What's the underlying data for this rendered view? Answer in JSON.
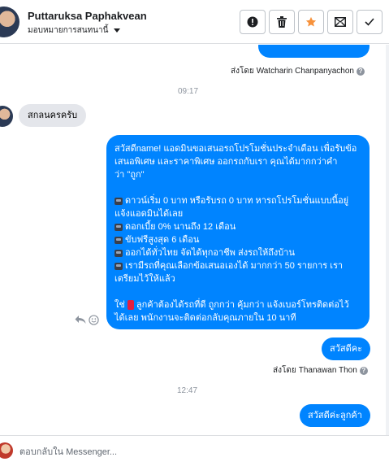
{
  "header": {
    "name": "Puttaruksa Paphakvean",
    "assign_label": "มอบหมายการสนทนานี้",
    "actions": [
      "spam-icon",
      "trash-icon",
      "star-icon",
      "mail-icon",
      "check-icon"
    ],
    "star_color": "#f7923b"
  },
  "messages": {
    "top_sent_by_prefix": "ส่งโดย",
    "top_sent_by": "Watcharin Chanpanyachon",
    "time1": "09:17",
    "incoming": "สกลนครครับ",
    "promo": {
      "line1": "สวัสดีname! แอดมินขอเสนอรถโปรโมชั่นประจำเดือน เพื่อรับข้อ",
      "line2": "เสนอพิเศษ และราคาพิเศษ ออกรถกับเรา คุณได้มากกว่าคำ",
      "line3": "ว่า \"ถูก\"",
      "b1a": "ดาวน์เริ่ม 0 บาท หรือรับรถ 0 บาท หารถโปรโมชั่นแบบนี้อยู่",
      "b1b": "แจ้งแอดมินได้เลย",
      "b2": "ดอกเบี้ย 0% นานถึง 12 เดือน",
      "b3": "ขับฟรีสูงสุด 6 เดือน",
      "b4": "ออกได้ทั่วไทย จัดได้ทุกอาชีพ ส่งรถให้ถึงบ้าน",
      "b5a": "เรามีรถที่คุณเลือกข้อเสนอเองได้ มากกว่า 50 รายการ เรา",
      "b5b": "เตรียมไว้ให้แล้ว",
      "c1a": "ใช่",
      "c1b": "ลูกค้าต้องได้รถที่ดี ถูกกว่า คุ้มกว่า แจ้งเบอร์โทรติดต่อไว้",
      "c2": "ได้เลย พนักงานจะติดต่อกลับคุณภายใน 10 นาที"
    },
    "reply1": "สวัสดีคะ",
    "sent_by_prefix": "ส่งโดย",
    "sent_by2": "Thanawan Thon",
    "time2": "12:47",
    "reply2": "สวัสดีค่ะลูกค้า"
  },
  "composer": {
    "placeholder": "ตอบกลับใน Messenger..."
  },
  "colors": {
    "bubble_out": "#0084ff",
    "bubble_in": "#e4e6eb"
  }
}
